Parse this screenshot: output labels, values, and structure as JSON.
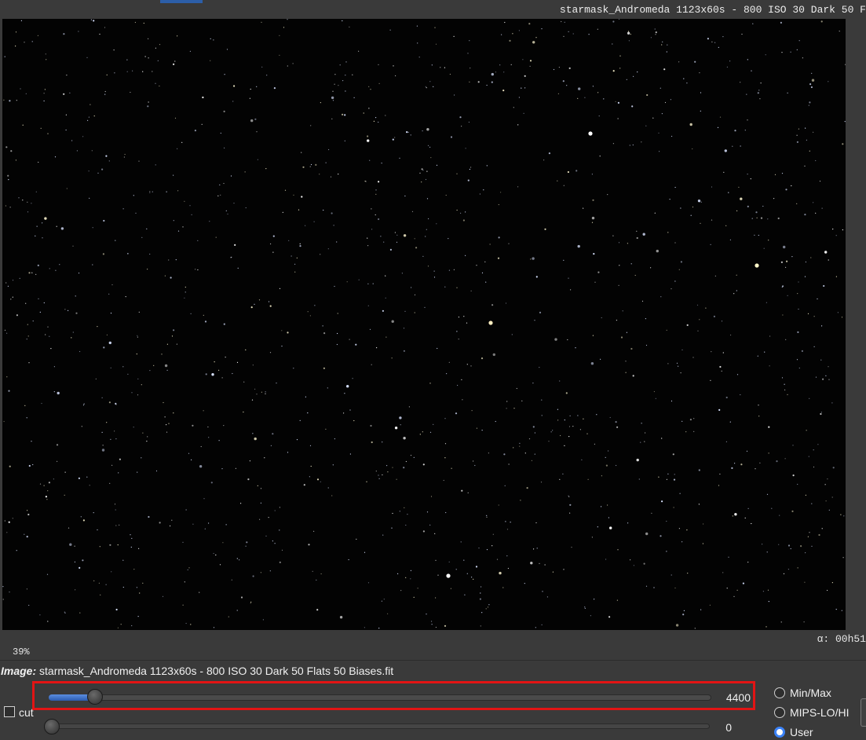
{
  "window": {
    "title_overlay": "starmask_Andromeda 1123x60s - 800 ISO 30 Dark 50 F",
    "zoom": "39%",
    "alpha_readout": "α: 00h51"
  },
  "image_info": {
    "label": "Image:",
    "filename": "starmask_Andromeda 1123x60s - 800 ISO 30 Dark 50 Flats 50 Biases.fit"
  },
  "sliders": {
    "high": {
      "value": "4400",
      "fraction": 0.07
    },
    "low": {
      "value": "0",
      "fraction": 0.0
    }
  },
  "cut_checkbox": {
    "label": "cut",
    "checked": false
  },
  "scaling_modes": [
    {
      "label": "Min/Max",
      "selected": false
    },
    {
      "label": "MIPS-LO/HI",
      "selected": false
    },
    {
      "label": "User",
      "selected": true
    }
  ],
  "colors": {
    "highlight_border": "#e21414",
    "accent": "#3b82f6",
    "sky": "#030303"
  }
}
